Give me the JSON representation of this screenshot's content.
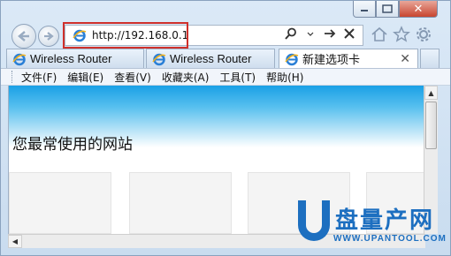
{
  "window": {
    "caption_close": "✕"
  },
  "address": {
    "url": "http://192.168.0.1"
  },
  "tabs": [
    {
      "label": "Wireless Router"
    },
    {
      "label": "Wireless Router"
    },
    {
      "label": "新建选项卡",
      "close": "✕"
    }
  ],
  "menu": [
    "文件(F)",
    "编辑(E)",
    "查看(V)",
    "收藏夹(A)",
    "工具(T)",
    "帮助(H)"
  ],
  "content": {
    "heading": "您最常使用的网站"
  },
  "watermark": {
    "brand": "盘量产网",
    "url": "WWW.UPANTOOL.COM"
  },
  "icons": {
    "back": "back-arrow-icon",
    "forward": "forward-arrow-icon",
    "page": "ie-icon",
    "search": "search-icon",
    "go": "go-arrow-icon",
    "stop": "stop-icon",
    "home": "home-icon",
    "favorites": "star-icon",
    "tools": "gear-icon"
  },
  "colors": {
    "highlight": "#d0302b",
    "sky_top": "#1aa0e6",
    "watermark": "#1d6fc0"
  }
}
